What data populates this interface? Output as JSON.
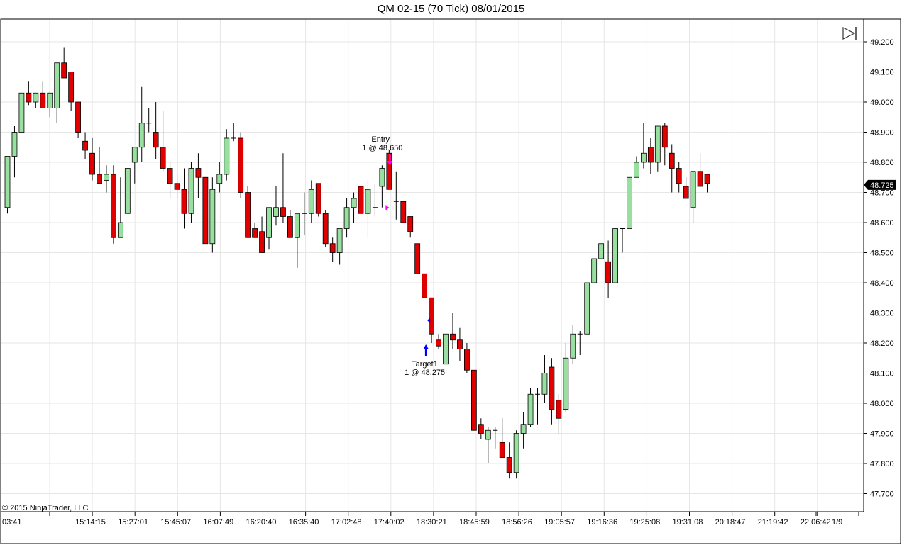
{
  "chart_data": {
    "type": "candlestick",
    "title": "QM 02-15 (70 Tick)  08/01/2015",
    "copyright": "© 2015 NinjaTrader, LLC",
    "ylim": [
      47.65,
      49.25
    ],
    "y_ticks": [
      "49.200",
      "49.100",
      "49.000",
      "48.900",
      "48.800",
      "48.700",
      "48.600",
      "48.500",
      "48.400",
      "48.300",
      "48.200",
      "48.100",
      "48.000",
      "47.900",
      "47.800",
      "47.700"
    ],
    "x_ticks": [
      "03:41",
      "15:14:15",
      "15:27:01",
      "15:45:07",
      "16:07:49",
      "16:20:40",
      "16:35:40",
      "17:02:48",
      "17:40:02",
      "18:30:21",
      "18:45:59",
      "18:56:26",
      "19:05:57",
      "19:16:36",
      "19:25:08",
      "19:31:08",
      "20:18:47",
      "21:19:42",
      "22:06:42"
    ],
    "page_label": "1/9",
    "last_price": "48.725",
    "colors": {
      "up": "#98e0a0",
      "down": "#e00000",
      "outline": "#000000",
      "grid": "#e6e6e6",
      "entry_marker": "#ff00ff",
      "target_marker": "#0000ff"
    },
    "annotations": [
      {
        "label": "Entry",
        "detail": "1 @ 48.650",
        "bar": 53,
        "side": "sell"
      },
      {
        "label": "Target1",
        "detail": "1 @ 48.275",
        "bar": 59,
        "side": "buy"
      }
    ],
    "candles": [
      [
        48.65,
        48.82,
        48.63,
        48.82
      ],
      [
        48.82,
        48.92,
        48.75,
        48.9
      ],
      [
        48.9,
        49.03,
        48.9,
        49.03
      ],
      [
        49.03,
        49.07,
        48.99,
        49.0
      ],
      [
        49.0,
        49.03,
        48.98,
        49.03
      ],
      [
        49.03,
        49.07,
        48.99,
        48.98
      ],
      [
        48.98,
        49.03,
        48.95,
        49.03
      ],
      [
        48.98,
        49.13,
        48.93,
        49.13
      ],
      [
        49.13,
        49.18,
        49.08,
        49.08
      ],
      [
        49.1,
        49.1,
        48.97,
        49.0
      ],
      [
        49.0,
        49.0,
        48.88,
        48.9
      ],
      [
        48.87,
        48.9,
        48.81,
        48.84
      ],
      [
        48.83,
        48.88,
        48.74,
        48.76
      ],
      [
        48.76,
        48.85,
        48.73,
        48.73
      ],
      [
        48.74,
        48.79,
        48.7,
        48.76
      ],
      [
        48.76,
        48.79,
        48.53,
        48.55
      ],
      [
        48.55,
        48.75,
        48.55,
        48.6
      ],
      [
        48.63,
        48.78,
        48.63,
        48.78
      ],
      [
        48.8,
        48.84,
        48.73,
        48.85
      ],
      [
        48.85,
        49.05,
        48.8,
        48.93
      ],
      [
        48.93,
        48.98,
        48.9,
        48.93
      ],
      [
        48.9,
        49.0,
        48.81,
        48.85
      ],
      [
        48.85,
        48.97,
        48.77,
        48.78
      ],
      [
        48.78,
        48.8,
        48.68,
        48.73
      ],
      [
        48.73,
        48.76,
        48.68,
        48.71
      ],
      [
        48.71,
        48.78,
        48.58,
        48.63
      ],
      [
        48.63,
        48.8,
        48.6,
        48.78
      ],
      [
        48.78,
        48.83,
        48.68,
        48.75
      ],
      [
        48.75,
        48.74,
        48.53,
        48.53
      ],
      [
        48.53,
        48.75,
        48.5,
        48.71
      ],
      [
        48.73,
        48.8,
        48.7,
        48.76
      ],
      [
        48.76,
        48.91,
        48.74,
        48.88
      ],
      [
        48.88,
        48.93,
        48.87,
        48.88
      ],
      [
        48.88,
        48.9,
        48.68,
        48.7
      ],
      [
        48.7,
        48.72,
        48.55,
        48.55
      ],
      [
        48.58,
        48.6,
        48.55,
        48.55
      ],
      [
        48.57,
        48.62,
        48.5,
        48.5
      ],
      [
        48.55,
        48.65,
        48.51,
        48.65
      ],
      [
        48.62,
        48.72,
        48.59,
        48.65
      ],
      [
        48.65,
        48.83,
        48.6,
        48.62
      ],
      [
        48.62,
        48.64,
        48.55,
        48.55
      ],
      [
        48.55,
        48.63,
        48.45,
        48.63
      ],
      [
        48.63,
        48.7,
        48.56,
        48.63
      ],
      [
        48.63,
        48.74,
        48.6,
        48.71
      ],
      [
        48.73,
        48.73,
        48.62,
        48.63
      ],
      [
        48.63,
        48.64,
        48.52,
        48.53
      ],
      [
        48.53,
        48.55,
        48.47,
        48.5
      ],
      [
        48.5,
        48.57,
        48.46,
        48.58
      ],
      [
        48.58,
        48.68,
        48.55,
        48.65
      ],
      [
        48.65,
        48.7,
        48.6,
        48.68
      ],
      [
        48.72,
        48.77,
        48.57,
        48.63
      ],
      [
        48.63,
        48.74,
        48.55,
        48.71
      ],
      [
        48.65,
        48.73,
        48.62,
        48.65
      ],
      [
        48.72,
        48.79,
        48.65,
        48.78
      ],
      [
        48.83,
        48.84,
        48.71,
        48.71
      ],
      [
        48.67,
        48.77,
        48.61,
        48.67
      ],
      [
        48.67,
        48.67,
        48.6,
        48.6
      ],
      [
        48.62,
        48.62,
        48.55,
        48.57
      ],
      [
        48.53,
        48.53,
        48.43,
        48.43
      ],
      [
        48.43,
        48.43,
        48.35,
        48.35
      ],
      [
        48.35,
        48.35,
        48.2,
        48.23
      ],
      [
        48.21,
        48.23,
        48.18,
        48.19
      ],
      [
        48.13,
        48.23,
        48.13,
        48.23
      ],
      [
        48.23,
        48.3,
        48.18,
        48.21
      ],
      [
        48.21,
        48.25,
        48.14,
        48.18
      ],
      [
        48.18,
        48.2,
        48.1,
        48.11
      ],
      [
        48.11,
        48.11,
        47.91,
        47.91
      ],
      [
        47.93,
        47.95,
        47.88,
        47.9
      ],
      [
        47.88,
        47.92,
        47.8,
        47.91
      ],
      [
        47.91,
        47.92,
        47.85,
        47.91
      ],
      [
        47.87,
        47.95,
        47.82,
        47.82
      ],
      [
        47.82,
        47.87,
        47.75,
        47.77
      ],
      [
        47.77,
        47.91,
        47.75,
        47.9
      ],
      [
        47.9,
        47.97,
        47.85,
        47.93
      ],
      [
        47.93,
        48.05,
        47.92,
        48.03
      ],
      [
        48.03,
        48.05,
        47.93,
        48.03
      ],
      [
        48.03,
        48.16,
        48.0,
        48.1
      ],
      [
        48.12,
        48.15,
        47.93,
        47.98
      ],
      [
        48.01,
        48.03,
        47.9,
        47.95
      ],
      [
        47.98,
        48.2,
        47.97,
        48.15
      ],
      [
        48.15,
        48.26,
        48.13,
        48.23
      ],
      [
        48.23,
        48.24,
        48.16,
        48.23
      ],
      [
        48.23,
        48.4,
        48.23,
        48.4
      ],
      [
        48.4,
        48.48,
        48.4,
        48.48
      ],
      [
        48.48,
        48.53,
        48.48,
        48.53
      ],
      [
        48.47,
        48.54,
        48.35,
        48.4
      ],
      [
        48.4,
        48.58,
        48.4,
        48.58
      ],
      [
        48.58,
        48.58,
        48.5,
        48.58
      ],
      [
        48.58,
        48.75,
        48.58,
        48.75
      ],
      [
        48.75,
        48.82,
        48.75,
        48.8
      ],
      [
        48.8,
        48.93,
        48.78,
        48.83
      ],
      [
        48.85,
        48.88,
        48.76,
        48.8
      ],
      [
        48.8,
        48.92,
        48.77,
        48.92
      ],
      [
        48.92,
        48.93,
        48.79,
        48.85
      ],
      [
        48.83,
        48.86,
        48.7,
        48.78
      ],
      [
        48.78,
        48.8,
        48.7,
        48.73
      ],
      [
        48.72,
        48.75,
        48.68,
        48.68
      ],
      [
        48.65,
        48.77,
        48.6,
        48.77
      ],
      [
        48.77,
        48.83,
        48.72,
        48.72
      ],
      [
        48.76,
        48.76,
        48.7,
        48.73
      ]
    ]
  }
}
